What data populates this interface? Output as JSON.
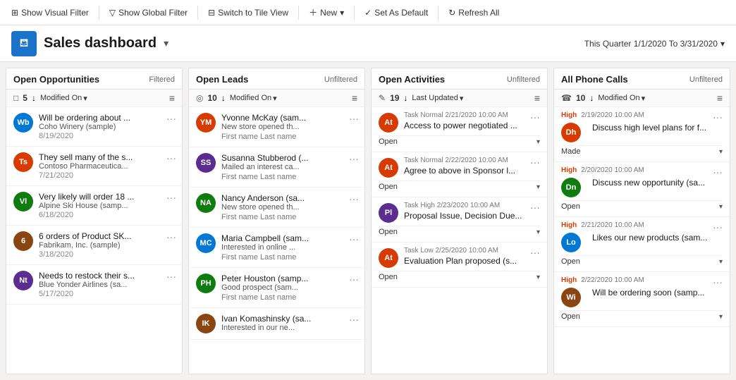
{
  "toolbar": {
    "visual_filter": "Show Visual Filter",
    "global_filter": "Show Global Filter",
    "tile_view": "Switch to Tile View",
    "new": "New",
    "set_default": "Set As Default",
    "refresh": "Refresh All"
  },
  "header": {
    "title": "Sales dashboard",
    "period": "This Quarter 1/1/2020 To 3/31/2020"
  },
  "columns": [
    {
      "id": "open-opportunities",
      "title": "Open Opportunities",
      "badge": "Filtered",
      "count": "5",
      "sort": "Modified On",
      "cards": [
        {
          "initials": "Wb",
          "color": "#0078d4",
          "title": "Will be ordering about ...",
          "sub": "Coho Winery (sample)",
          "date": "8/19/2020",
          "type": "standard"
        },
        {
          "initials": "Ts",
          "color": "#d83b01",
          "title": "They sell many of the s...",
          "sub": "Contoso Pharmaceutica...",
          "date": "7/21/2020",
          "type": "standard"
        },
        {
          "initials": "Vl",
          "color": "#107c10",
          "title": "Very likely will order 18 ...",
          "sub": "Alpine Ski House (samp...",
          "date": "6/18/2020",
          "type": "standard"
        },
        {
          "number": "6",
          "color": "#8b4513",
          "title": "6 orders of Product SK...",
          "sub": "Fabrikam, Inc. (sample)",
          "date": "3/18/2020",
          "type": "number"
        },
        {
          "initials": "Nt",
          "color": "#5c2d91",
          "title": "Needs to restock their s...",
          "sub": "Blue Yonder Airlines (sa...",
          "date": "5/17/2020",
          "type": "standard"
        }
      ]
    },
    {
      "id": "open-leads",
      "title": "Open Leads",
      "badge": "Unfiltered",
      "count": "10",
      "sort": "Modified On",
      "cards": [
        {
          "initials": "YM",
          "color": "#d83b01",
          "title": "Yvonne McKay (sam...",
          "sub": "New store opened th...",
          "meta": "First name Last name",
          "type": "lead"
        },
        {
          "initials": "SS",
          "color": "#5c2d91",
          "title": "Susanna Stubberod (...",
          "sub": "Mailed an interest ca...",
          "meta": "First name Last name",
          "type": "lead"
        },
        {
          "initials": "NA",
          "color": "#107c10",
          "title": "Nancy Anderson (sa...",
          "sub": "New store opened th...",
          "meta": "First name Last name",
          "type": "lead"
        },
        {
          "initials": "MC",
          "color": "#0078d4",
          "title": "Maria Campbell (sam...",
          "sub": "Interested in online ...",
          "meta": "First name Last name",
          "type": "lead"
        },
        {
          "initials": "PH",
          "color": "#107c10",
          "title": "Peter Houston (samp...",
          "sub": "Good prospect (sam...",
          "meta": "First name Last name",
          "type": "lead"
        },
        {
          "initials": "IK",
          "color": "#8b4513",
          "title": "Ivan Komashinsky (sa...",
          "sub": "Interested in our ne...",
          "meta": "",
          "type": "lead"
        }
      ]
    },
    {
      "id": "open-activities",
      "title": "Open Activities",
      "badge": "Unfiltered",
      "count": "19",
      "sort": "Last Updated",
      "cards": [
        {
          "initials": "At",
          "color": "#d83b01",
          "type_label": "Task",
          "priority": "Normal",
          "date": "2/21/2020 10:00 AM",
          "title": "Access to power negotiated ...",
          "status": "Open"
        },
        {
          "initials": "At",
          "color": "#d83b01",
          "type_label": "Task",
          "priority": "Normal",
          "date": "2/22/2020 10:00 AM",
          "title": "Agree to above in Sponsor l...",
          "status": "Open"
        },
        {
          "initials": "Pl",
          "color": "#5c2d91",
          "type_label": "Task",
          "priority": "High",
          "date": "2/23/2020 10:00 AM",
          "title": "Proposal Issue, Decision Due...",
          "status": "Open"
        },
        {
          "initials": "At",
          "color": "#d83b01",
          "type_label": "Task",
          "priority": "Low",
          "date": "2/25/2020 10:00 AM",
          "title": "Evaluation Plan proposed (s...",
          "status": "Open"
        }
      ]
    },
    {
      "id": "all-phone-calls",
      "title": "All Phone Calls",
      "badge": "Unfiltered",
      "count": "10",
      "sort": "Modified On",
      "cards": [
        {
          "initials": "Dh",
          "color": "#d83b01",
          "priority": "High",
          "date": "2/19/2020 10:00 AM",
          "title": "Discuss high level plans for f...",
          "status": "Made"
        },
        {
          "initials": "Dn",
          "color": "#107c10",
          "priority": "High",
          "date": "2/20/2020 10:00 AM",
          "title": "Discuss new opportunity (sa...",
          "status": "Open"
        },
        {
          "initials": "Lo",
          "color": "#0078d4",
          "priority": "High",
          "date": "2/21/2020 10:00 AM",
          "title": "Likes our new products (sam...",
          "status": "Open"
        },
        {
          "initials": "Wi",
          "color": "#8b4513",
          "priority": "High",
          "date": "2/22/2020 10:00 AM",
          "title": "Will be ordering soon (samp...",
          "status": "Open"
        }
      ]
    }
  ]
}
